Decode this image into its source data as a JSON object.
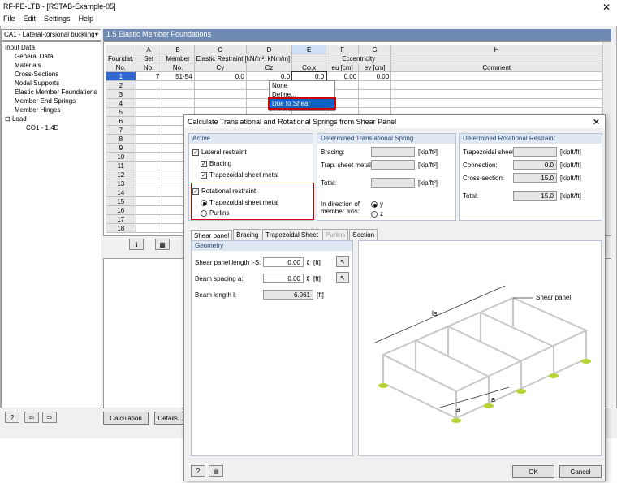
{
  "window": {
    "title": "RF-FE-LTB - [RSTAB-Example-05]",
    "close": "✕"
  },
  "menu": [
    "File",
    "Edit",
    "Settings",
    "Help"
  ],
  "case_selector": "CA1 - Lateral-torsional buckling",
  "tree": {
    "root": "Input Data",
    "items": [
      "General Data",
      "Materials",
      "Cross-Sections",
      "Nodal Supports",
      "Elastic Member Foundations",
      "Member End Springs",
      "Member Hinges"
    ],
    "load": "Load",
    "load_item": "CO1 - 1.4D"
  },
  "section_title": "1.5 Elastic Member Foundations",
  "grid": {
    "col_letters": [
      "A",
      "B",
      "C",
      "D",
      "E",
      "F",
      "G",
      "H"
    ],
    "header_groups": {
      "foundat": "Foundat.",
      "no": "No.",
      "set": "Set",
      "set_no": "No.",
      "member": "Member",
      "member_no": "No.",
      "elastic": "Elastic Restraint",
      "elastic_unit": "[kN/m², kNm/m]",
      "eccentricity": "Eccentricity",
      "comment": "Comment"
    },
    "sub_headers": [
      "Cy",
      "Cz",
      "Cφ,x",
      "eu [cm]",
      "ev [cm]"
    ],
    "rows": [
      "1",
      "2",
      "3",
      "4",
      "5",
      "6",
      "7",
      "8",
      "9",
      "10",
      "11",
      "12",
      "13",
      "14",
      "15",
      "16",
      "17",
      "18"
    ],
    "row1": [
      "7",
      "51-54",
      "0.0",
      "0.0",
      "0.0",
      "0.00",
      "0.00"
    ]
  },
  "dropdown": {
    "items": [
      "None",
      "Define...",
      "Due to Shear Panel..."
    ]
  },
  "bottom": {
    "calculation": "Calculation",
    "details": "Details..."
  },
  "dialog": {
    "title": "Calculate Translational and Rotational Springs from Shear Panel",
    "active": {
      "header": "Active",
      "lateral": "Lateral restraint",
      "bracing": "Bracing",
      "trap": "Trapezoidal sheet metal",
      "rotational": "Rotational restraint",
      "rot_trap": "Trapezoidal sheet metal",
      "purlins": "Purlins"
    },
    "trans": {
      "header": "Determined Translational Spring",
      "bracing": "Bracing:",
      "trap": "Trap. sheet metal:",
      "total": "Total:",
      "unit": "[kip/ft²]",
      "direction": "In direction of member axis:",
      "y": "y",
      "z": "z"
    },
    "rot": {
      "header": "Determined Rotational Restraint",
      "trap": "Trapezoidal sheet",
      "connection": "Connection:",
      "cross": "Cross-section:",
      "total": "Total:",
      "unit": "[kipft/ft]",
      "conn_val": "0.0",
      "cross_val": "15.0",
      "total_val": "15.0"
    },
    "tabs": [
      "Shear panel",
      "Bracing",
      "Trapezoidal Sheet",
      "Purlins",
      "Section"
    ],
    "geometry": {
      "header": "Geometry",
      "ls": "Shear panel length l-S:",
      "ls_val": "0.00",
      "a": "Beam spacing a:",
      "a_val": "0.00",
      "l": "Beam length l:",
      "l_val": "6.061",
      "unit": "[ft]"
    },
    "figure": {
      "label": "Shear panel",
      "ls": "ls",
      "a1": "a",
      "a2": "a"
    },
    "ok": "OK",
    "cancel": "Cancel"
  }
}
